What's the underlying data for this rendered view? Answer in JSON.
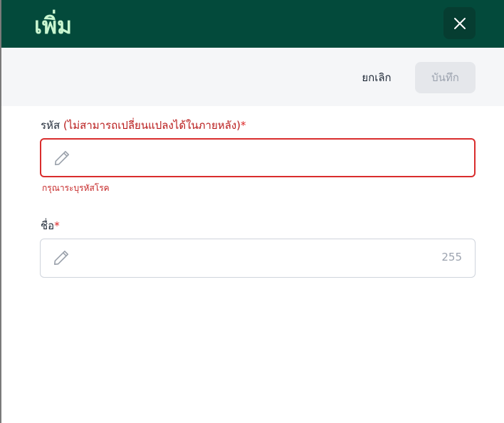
{
  "header": {
    "title": "เพิ่ม"
  },
  "toolbar": {
    "cancel_label": "ยกเลิก",
    "save_label": "บันทึก"
  },
  "form": {
    "code": {
      "label": "รหัส",
      "note": "(ไม่สามารถเปลี่ยนแปลงได้ในภายหลัง)",
      "required_mark": "*",
      "value": "",
      "error": "กรุณาระบุรหัสโรค"
    },
    "name": {
      "label": "ชื่อ",
      "required_mark": "*",
      "value": "",
      "counter": "255"
    }
  },
  "colors": {
    "header_bg": "#034a3b",
    "title": "#c8f5cf",
    "error": "#d92d2d"
  },
  "icons": {
    "close": "close-icon",
    "edit": "pencil-icon"
  }
}
